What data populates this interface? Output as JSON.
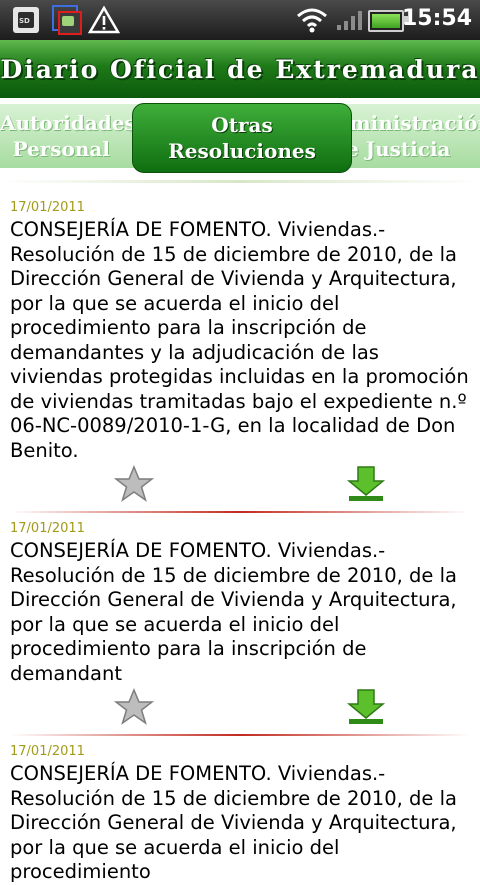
{
  "status_bar": {
    "time": "15:54",
    "sd_label": "SD"
  },
  "app": {
    "title": "Diario Oficial de Extremadura"
  },
  "tabs": {
    "left": {
      "line1": "Autoridades y",
      "line2": "Personal"
    },
    "active": {
      "line1": "Otras",
      "line2": "Resoluciones"
    },
    "right": {
      "line1": "Administración",
      "line2": "de Justicia"
    }
  },
  "items": [
    {
      "date": "17/01/2011",
      "text": "CONSEJERÍA DE FOMENTO. Viviendas.- Resolución de 15 de diciembre de 2010, de la Dirección General de Vivienda y Arquitectura, por la que se acuerda el inicio del procedimiento para la inscripción de demandantes y la adjudicación de las viviendas protegidas incluidas en la promoción de viviendas tramitadas bajo el expediente n.º 06-NC-0089/2010-1-G, en la localidad de Don Benito."
    },
    {
      "date": "17/01/2011",
      "text": "CONSEJERÍA DE FOMENTO. Viviendas.- Resolución de 15 de diciembre de 2010, de la Dirección General de Vivienda y Arquitectura, por la que se acuerda el inicio del procedimiento para la inscripción de demandant"
    },
    {
      "date": "17/01/2011",
      "text": "CONSEJERÍA DE FOMENTO. Viviendas.- Resolución de 15 de diciembre de 2010, de la Dirección General de Vivienda y Arquitectura, por la que se acuerda el inicio del procedimiento"
    }
  ],
  "icons": {
    "favorite": "star-icon",
    "download": "download-arrow-icon"
  },
  "colors": {
    "brand_green": "#1e7a18",
    "date_color": "#a29a1a",
    "separator": "#c22a1f"
  }
}
